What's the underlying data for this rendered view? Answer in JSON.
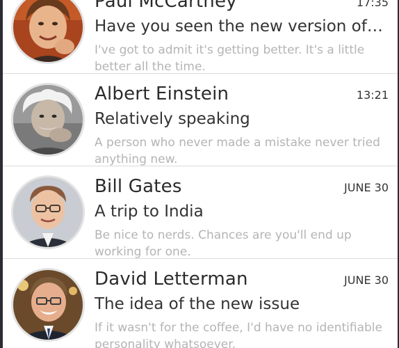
{
  "messages": [
    {
      "sender": "Paul McCartney",
      "time": "17:35",
      "subject": "Have you seen the new version of My Life?",
      "preview": "I've got to admit it's getting better. It's a little better all the time.",
      "avatar_icon": "avatar-paul-mccartney"
    },
    {
      "sender": "Albert Einstein",
      "time": "13:21",
      "subject": "Relatively speaking",
      "preview": "A person who never made a mistake never tried anything new.",
      "avatar_icon": "avatar-albert-einstein"
    },
    {
      "sender": "Bill Gates",
      "time": "JUNE 30",
      "subject": "A trip to India",
      "preview": "Be nice to nerds. Chances are you'll end up working for one.",
      "avatar_icon": "avatar-bill-gates"
    },
    {
      "sender": "David Letterman",
      "time": "JUNE 30",
      "subject": "The idea of the new issue",
      "preview": "If it wasn't for the coffee, I'd have no identifiable personality whatsoever.",
      "avatar_icon": "avatar-david-letterman"
    }
  ]
}
